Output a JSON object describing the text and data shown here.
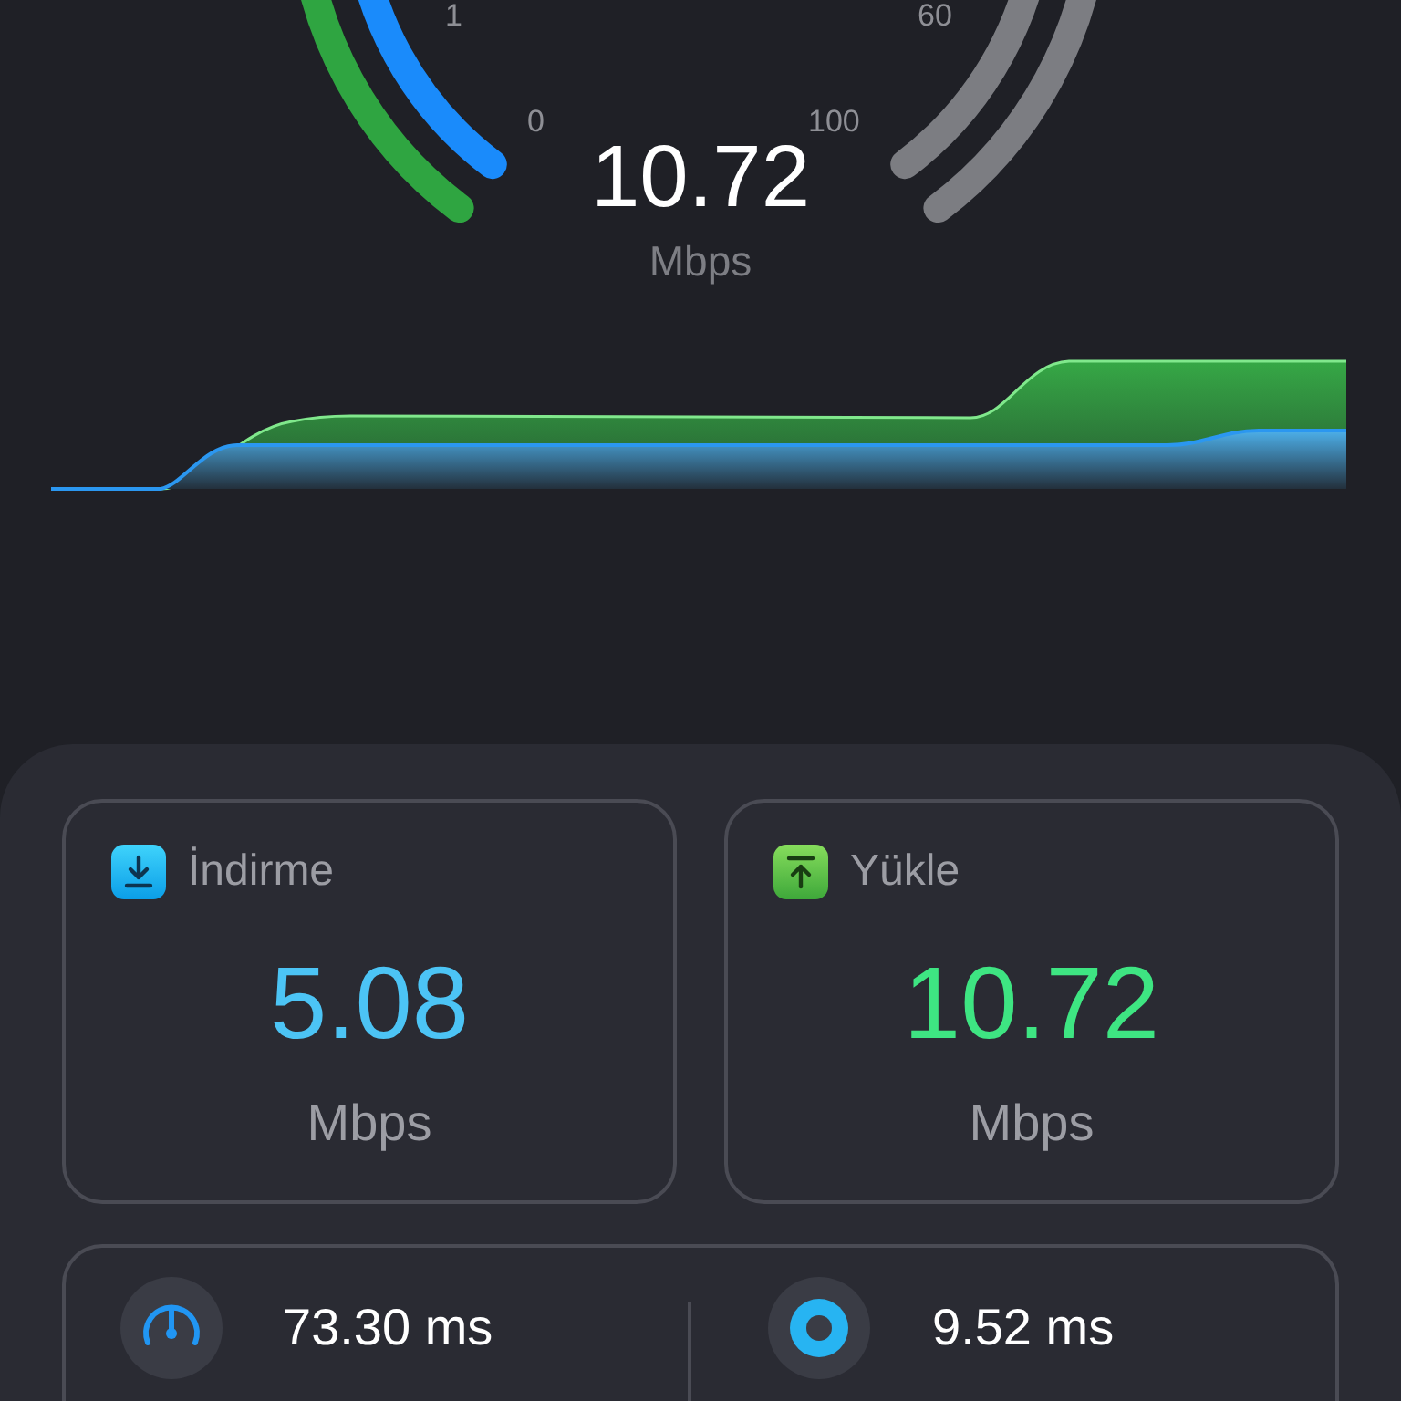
{
  "gauge": {
    "tick_labels": [
      "1",
      "0",
      "100",
      "60"
    ],
    "value": "10.72",
    "unit": "Mbps"
  },
  "cards": [
    {
      "kind": "download",
      "label": "İndirme",
      "value": "5.08",
      "unit": "Mbps",
      "color": "#4cc4f5"
    },
    {
      "kind": "upload",
      "label": "Yükle",
      "value": "10.72",
      "unit": "Mbps",
      "color": "#3ee582"
    }
  ],
  "latency": [
    {
      "kind": "gauge",
      "value": "73.30 ms"
    },
    {
      "kind": "ring",
      "value": "9.52 ms"
    }
  ]
}
